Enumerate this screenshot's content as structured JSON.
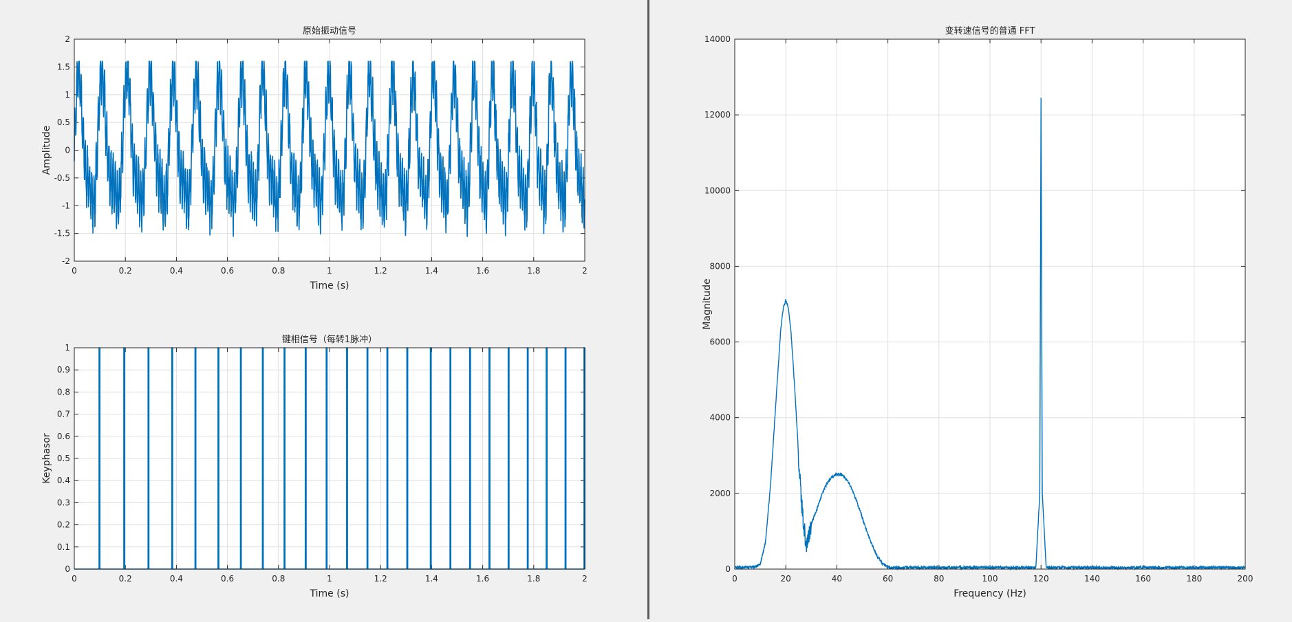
{
  "chart_data": [
    {
      "type": "line",
      "title": "原始振动信号",
      "xlabel": "Time (s)",
      "ylabel": "Amplitude",
      "xlim": [
        0,
        2
      ],
      "ylim": [
        -2,
        2
      ],
      "xticks": [
        "0",
        "0.2",
        "0.4",
        "0.6",
        "0.8",
        "1",
        "1.2",
        "1.4",
        "1.6",
        "1.8",
        "2"
      ],
      "yticks": [
        "-2",
        "-1.5",
        "-1",
        "-0.5",
        "0",
        "0.5",
        "1",
        "1.5",
        "2"
      ],
      "grid": true,
      "color": "#0072bd",
      "series": [
        {
          "peaks_x": [
            0.02,
            0.11,
            0.21,
            0.3,
            0.39,
            0.48,
            0.57,
            0.66,
            0.74,
            0.83,
            0.91,
            1.0,
            1.08,
            1.16,
            1.25,
            1.33,
            1.41,
            1.49,
            1.57,
            1.64,
            1.72,
            1.8,
            1.87,
            1.95
          ],
          "peak_amplitude": 1.6,
          "trough_amplitude": -1.95
        }
      ]
    },
    {
      "type": "line",
      "title": "键相信号（每转1脉冲）",
      "xlabel": "Time (s)",
      "ylabel": "Keyphasor",
      "xlim": [
        0,
        2
      ],
      "ylim": [
        0,
        1
      ],
      "xticks": [
        "0",
        "0.2",
        "0.4",
        "0.6",
        "0.8",
        "1",
        "1.2",
        "1.4",
        "1.6",
        "1.8",
        "2"
      ],
      "yticks": [
        "0",
        "0.1",
        "0.2",
        "0.3",
        "0.4",
        "0.5",
        "0.6",
        "0.7",
        "0.8",
        "0.9",
        "1"
      ],
      "grid": true,
      "color": "#0072bd",
      "series": [
        {
          "pulse_times": [
            0.1,
            0.197,
            0.292,
            0.385,
            0.476,
            0.566,
            0.654,
            0.74,
            0.825,
            0.908,
            0.99,
            1.07,
            1.15,
            1.228,
            1.306,
            1.398,
            1.475,
            1.552,
            1.628,
            1.703,
            1.778,
            1.852,
            1.926,
            2.0
          ],
          "pulse_height": 1
        }
      ]
    },
    {
      "type": "line",
      "title": "变转速信号的普通 FFT",
      "xlabel": "Frequency (Hz)",
      "ylabel": "Magnitude",
      "xlim": [
        0,
        200
      ],
      "ylim": [
        0,
        14000
      ],
      "xticks": [
        "0",
        "20",
        "40",
        "60",
        "80",
        "100",
        "120",
        "140",
        "160",
        "180",
        "200"
      ],
      "yticks": [
        "0",
        "2000",
        "4000",
        "6000",
        "8000",
        "10000",
        "12000",
        "14000"
      ],
      "grid": true,
      "color": "#0072bd",
      "series": [
        {
          "x": [
            0,
            5,
            8,
            10,
            12,
            14,
            16,
            18,
            19,
            20,
            21,
            22,
            23,
            24,
            25,
            26,
            27,
            28,
            29,
            30,
            32,
            34,
            36,
            38,
            40,
            42,
            44,
            46,
            48,
            50,
            52,
            54,
            56,
            58,
            59,
            60,
            70,
            80,
            100,
            118,
            119.5,
            120,
            120.5,
            122,
            140,
            160,
            180,
            200
          ],
          "y": [
            30,
            50,
            60,
            120,
            700,
            2200,
            4300,
            6300,
            6900,
            7100,
            6900,
            6300,
            5300,
            4200,
            3000,
            1900,
            1200,
            600,
            900,
            1200,
            1550,
            1950,
            2250,
            2430,
            2520,
            2480,
            2350,
            2100,
            1750,
            1350,
            950,
            600,
            320,
            150,
            90,
            40,
            40,
            40,
            40,
            40,
            2000,
            12450,
            2000,
            40,
            40,
            40,
            40,
            40
          ]
        }
      ]
    }
  ]
}
